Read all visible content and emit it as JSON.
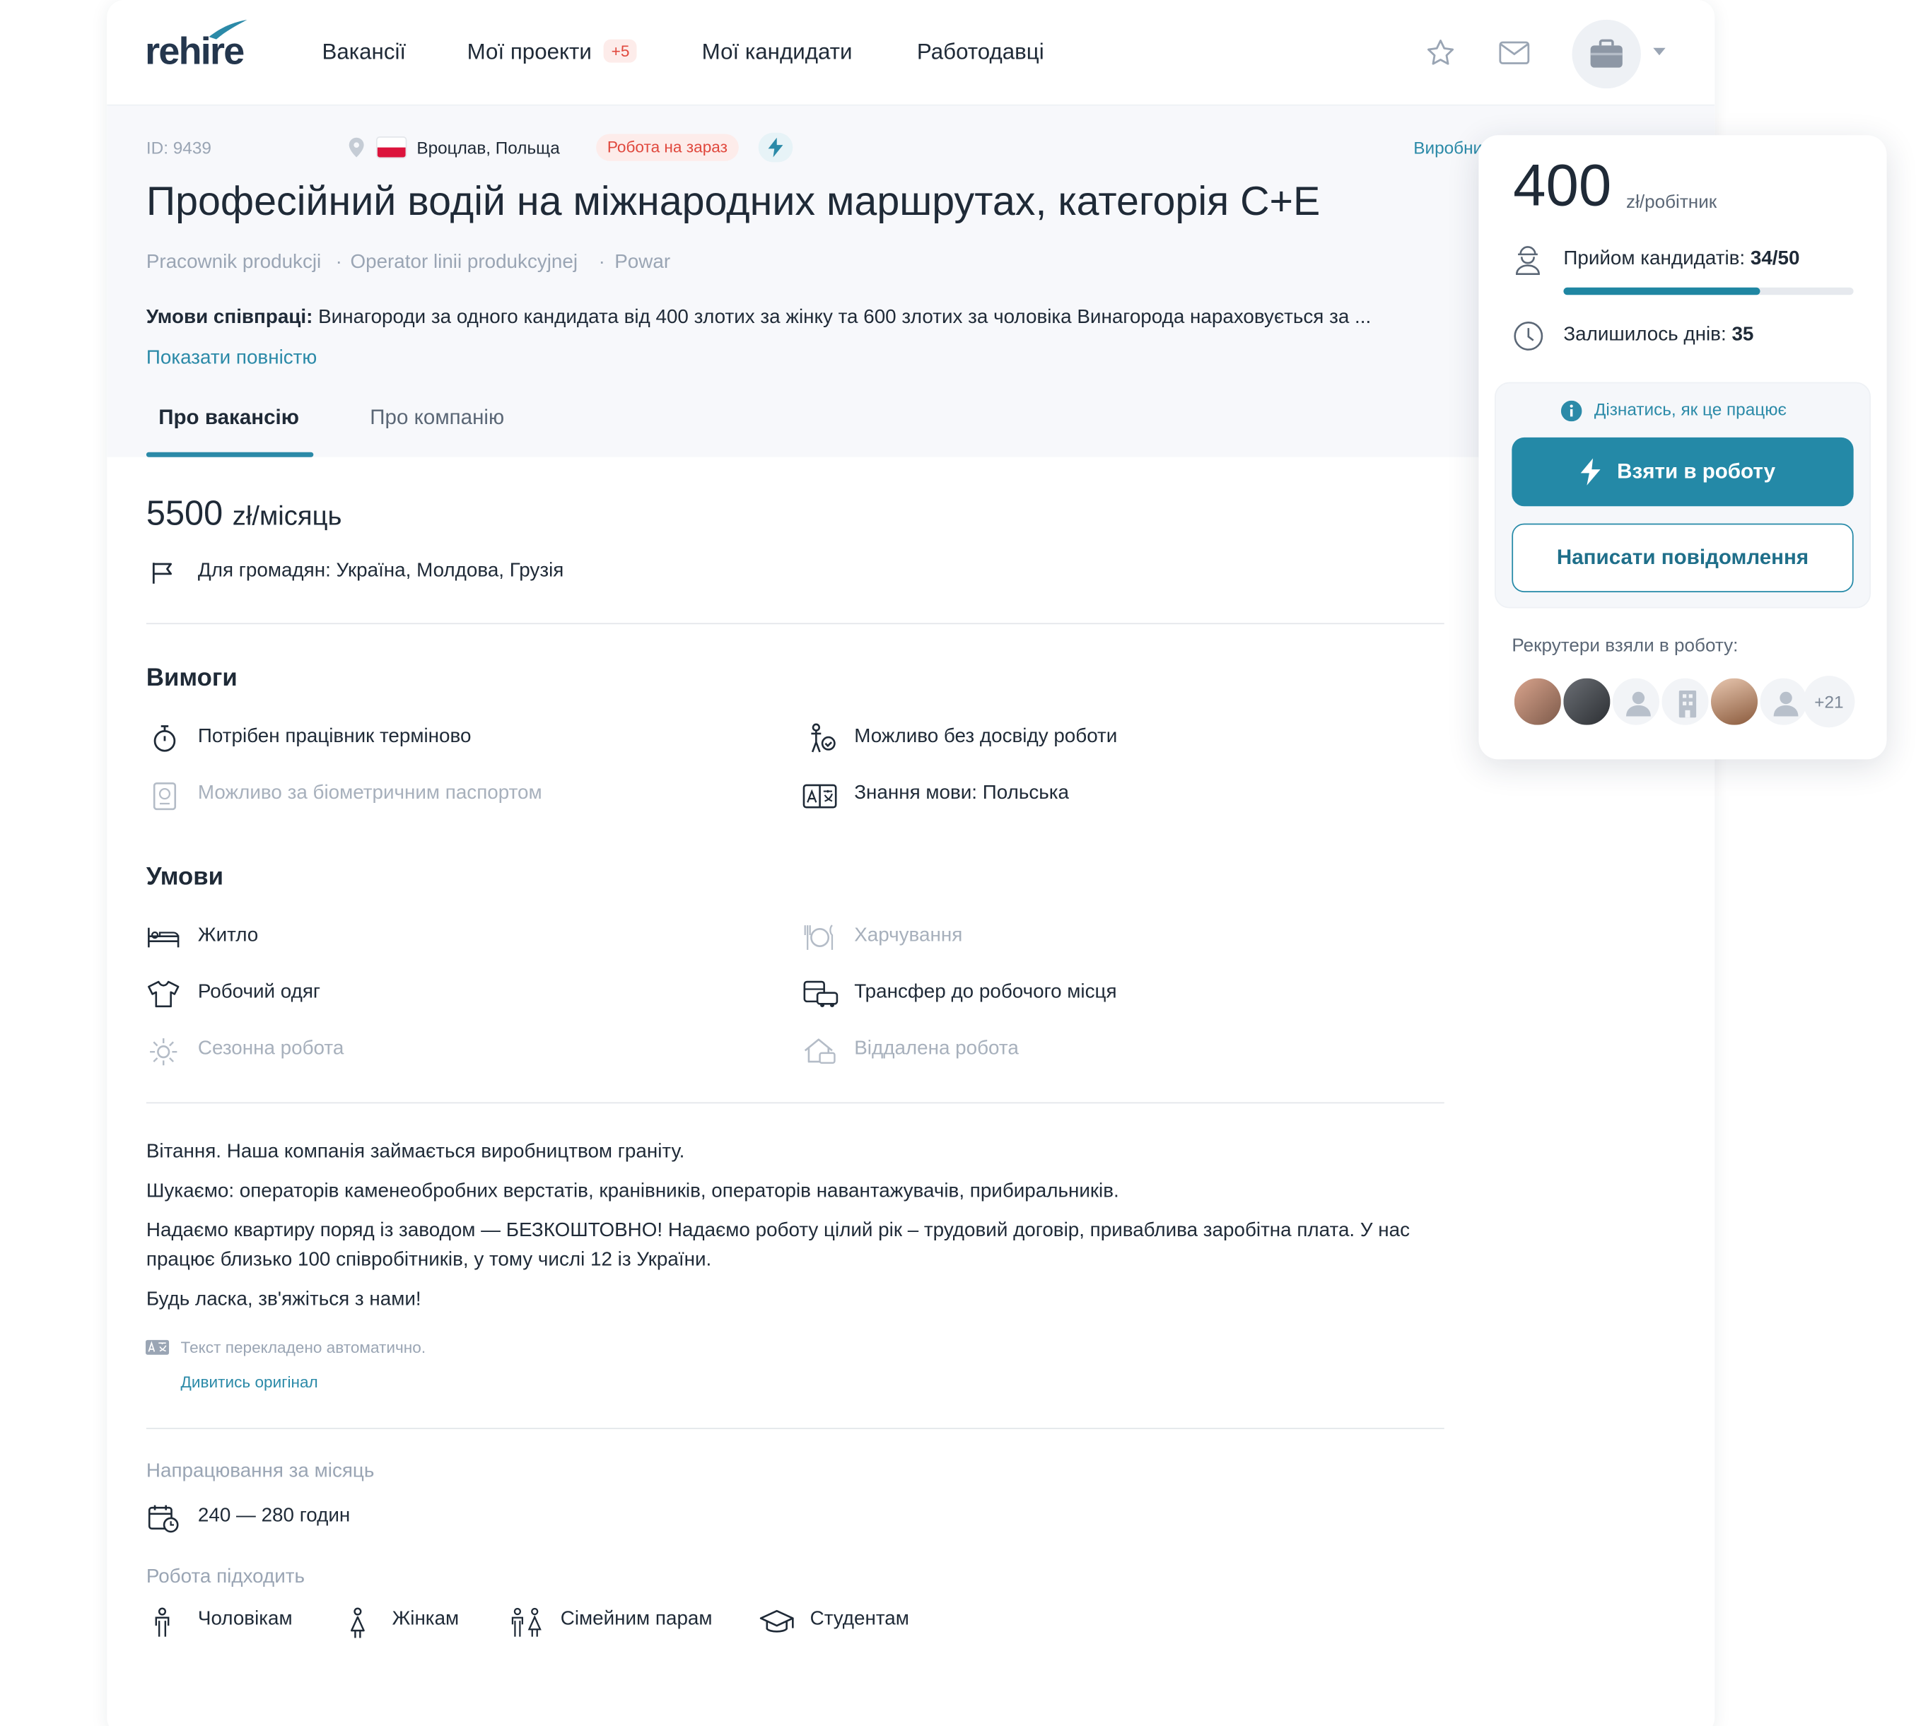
{
  "app": {
    "logo": "rehire"
  },
  "nav": {
    "items": [
      "Вакансії",
      "Мої проекти",
      "Мої кандидати",
      "Работодавці"
    ],
    "projects_badge": "+5"
  },
  "job": {
    "id": "ID: 9439",
    "location": "Вроцлав, Польща",
    "urgent_pill": "Робота на зараз",
    "category_link": "Виробництво",
    "title": "Професійний водій на міжнародних маршрутах, категорія С+Е",
    "tags": [
      "Pracownik produkcji",
      "Operator linii produkcyjnej",
      "Powar"
    ],
    "terms_label": "Умови співпраці:",
    "terms_text": " Винагороди за одного кандидата від 400 злотих за жінку та 600 злотих за чоловіка Винагорода нараховується за  ...",
    "show_more": "Показати повністю"
  },
  "tabs": [
    "Про вакансію",
    "Про компанію"
  ],
  "salary": {
    "amount": "5500",
    "unit": "zł/місяць"
  },
  "citizens": "Для громадян: Україна, Молдова, Грузія",
  "requirements": {
    "title": "Вимоги",
    "items": [
      {
        "label": "Потрібен працівник терміново",
        "icon": "stopwatch-icon",
        "active": true
      },
      {
        "label": "Можливо без досвіду роботи",
        "icon": "person-check-icon",
        "active": true
      },
      {
        "label": "Можливо за біометричним паспортом",
        "icon": "passport-icon",
        "active": false
      },
      {
        "label": "Знання мови: Польська",
        "icon": "translate-icon",
        "active": true
      }
    ]
  },
  "conditions": {
    "title": "Умови",
    "items": [
      {
        "label": "Житло",
        "icon": "bed-icon",
        "active": true
      },
      {
        "label": "Харчування",
        "icon": "meal-icon",
        "active": false
      },
      {
        "label": "Робочий одяг",
        "icon": "tshirt-icon",
        "active": true
      },
      {
        "label": "Трансфер до робочого місця",
        "icon": "bus-icon",
        "active": true
      },
      {
        "label": "Сезонна робота",
        "icon": "sun-icon",
        "active": false
      },
      {
        "label": "Віддалена робота",
        "icon": "home-icon",
        "active": false
      }
    ]
  },
  "description": {
    "p1": "Вітання. Наша компанія займається виробництвом граніту.",
    "p2": "Шукаємо: операторів каменеобробних верстатів, кранівників, операторів навантажувачів, прибиральників.",
    "p3": "Надаємо квартиру поряд із заводом — БЕЗКОШТОВНО! Надаємо роботу цілий рік – трудовий договір, приваблива заробітна плата. У нас працює близько 100 співробітників, у тому числі 12 із України.",
    "p4": "Будь ласка, зв'яжіться з нами!",
    "auto_note": "Текст перекладено автоматично.",
    "view_original": "Дивитись оригінал"
  },
  "hours": {
    "label": "Напрацювання за місяць",
    "value": "240 — 280 годин"
  },
  "suitable": {
    "label": "Робота підходить",
    "items": [
      "Чоловікам",
      "Жінкам",
      "Сімейним парам",
      "Студентам"
    ]
  },
  "panel": {
    "price": "400",
    "price_unit": "zł/робітник",
    "intake_label": "Прийом кандидатів:",
    "intake_value": "34/50",
    "intake_fraction": 0.68,
    "days_label": "Залишилось днів:",
    "days_value": "35",
    "how_it_works": "Дізнатись, як це працює",
    "take_button": "Взяти в роботу",
    "message_button": "Написати повідомлення",
    "recruiters_label": "Рекрутери взяли в роботу:",
    "recruiters_more": "+21"
  },
  "colors": {
    "accent": "#2489a7",
    "link": "#2b8aa8",
    "badge": "#e0483d"
  }
}
